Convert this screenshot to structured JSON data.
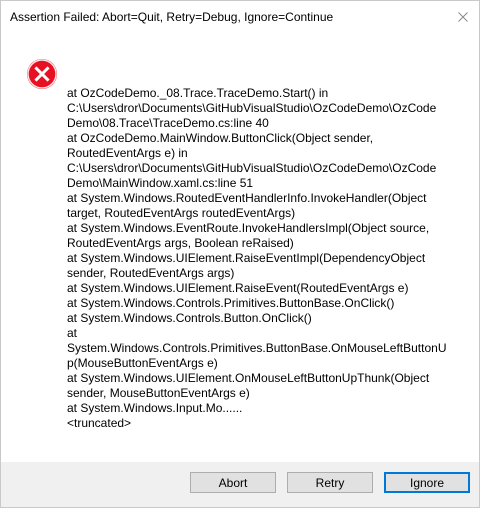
{
  "window": {
    "title": "Assertion Failed: Abort=Quit, Retry=Debug, Ignore=Continue"
  },
  "icons": {
    "close": "close-icon",
    "error": "error-icon"
  },
  "colors": {
    "error_red": "#e81123",
    "focus_blue": "#0078d7",
    "footer_gray": "#f0f0f0"
  },
  "message": {
    "lines": [
      "   at OzCodeDemo._08.Trace.TraceDemo.Start() in",
      "C:\\Users\\dror\\Documents\\GitHubVisualStudio\\OzCodeDemo\\OzCode",
      "Demo\\08.Trace\\TraceDemo.cs:line 40",
      "   at OzCodeDemo.MainWindow.ButtonClick(Object sender,",
      "RoutedEventArgs e) in",
      "C:\\Users\\dror\\Documents\\GitHubVisualStudio\\OzCodeDemo\\OzCode",
      "Demo\\MainWindow.xaml.cs:line 51",
      "   at System.Windows.RoutedEventHandlerInfo.InvokeHandler(Object",
      "target, RoutedEventArgs routedEventArgs)",
      "   at System.Windows.EventRoute.InvokeHandlersImpl(Object source,",
      "RoutedEventArgs args, Boolean reRaised)",
      "   at System.Windows.UIElement.RaiseEventImpl(DependencyObject",
      "sender, RoutedEventArgs args)",
      "   at System.Windows.UIElement.RaiseEvent(RoutedEventArgs e)",
      "   at System.Windows.Controls.Primitives.ButtonBase.OnClick()",
      "   at System.Windows.Controls.Button.OnClick()",
      "   at",
      "System.Windows.Controls.Primitives.ButtonBase.OnMouseLeftButtonU",
      "p(MouseButtonEventArgs e)",
      "   at System.Windows.UIElement.OnMouseLeftButtonUpThunk(Object",
      "sender, MouseButtonEventArgs e)",
      "   at System.Windows.Input.Mo......",
      "<truncated>"
    ]
  },
  "buttons": {
    "abort": "Abort",
    "retry": "Retry",
    "ignore": "Ignore"
  }
}
